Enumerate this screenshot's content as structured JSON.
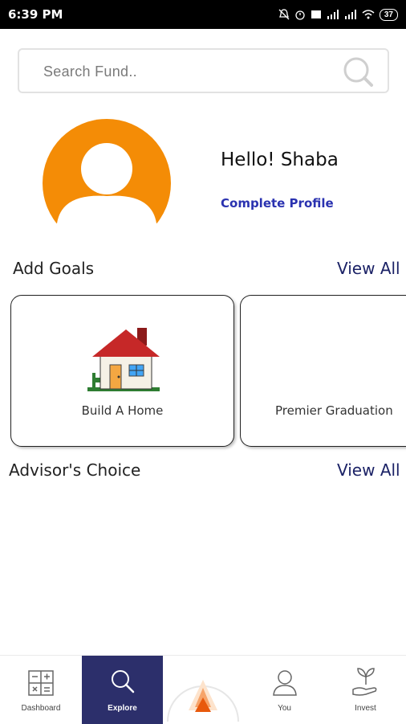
{
  "status_bar": {
    "time": "6:39 PM",
    "battery": "37"
  },
  "search": {
    "placeholder": "Search Fund.."
  },
  "profile": {
    "greeting": "Hello! Shaba",
    "complete_link": "Complete Profile"
  },
  "goals": {
    "title": "Add Goals",
    "view_all": "View All",
    "cards": [
      {
        "label": "Build A Home"
      },
      {
        "label": "Premier Graduation"
      }
    ]
  },
  "advisor": {
    "title": "Advisor's Choice",
    "view_all": "View All"
  },
  "bottom_nav": [
    {
      "label": "Dashboard",
      "icon": "calculator-icon"
    },
    {
      "label": "Explore",
      "icon": "search-icon",
      "active": true
    },
    {
      "label": "",
      "icon": "logo-icon"
    },
    {
      "label": "You",
      "icon": "person-icon"
    },
    {
      "label": "Invest",
      "icon": "plant-hand-icon"
    }
  ],
  "colors": {
    "accent": "#f48c06",
    "nav_active": "#2c2f6b",
    "link": "#2a32b0"
  }
}
